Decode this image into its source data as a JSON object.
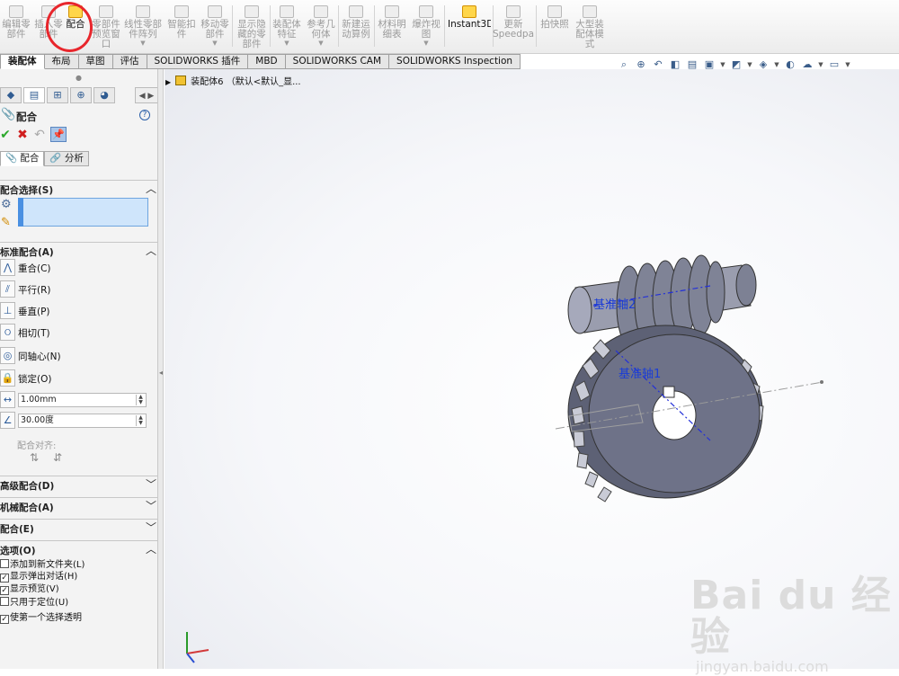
{
  "ribbon": [
    {
      "label": "编辑零\n部件",
      "active": false
    },
    {
      "label": "插入零\n部件",
      "active": false
    },
    {
      "label": "配合",
      "active": true
    },
    {
      "label": "零部件\n预览窗\n口",
      "active": false
    },
    {
      "label": "线性零部\n件阵列",
      "active": false
    },
    {
      "label": "智能扣\n件",
      "active": false
    },
    {
      "label": "移动零\n部件",
      "active": false
    },
    {
      "label": "显示隐\n藏的零\n部件",
      "active": false
    },
    {
      "label": "装配体\n特征",
      "active": false
    },
    {
      "label": "参考几\n何体",
      "active": false
    },
    {
      "label": "新建运\n动算例",
      "active": false
    },
    {
      "label": "材料明\n细表",
      "active": false
    },
    {
      "label": "爆炸视\n图",
      "active": false
    },
    {
      "label": "Instant3D",
      "active": true
    },
    {
      "label": "更新\nSpeedpak",
      "active": false
    },
    {
      "label": "拍快照",
      "active": false
    },
    {
      "label": "大型装\n配体模\n式",
      "active": false
    }
  ],
  "tabs": [
    "装配体",
    "布局",
    "草图",
    "评估",
    "SOLIDWORKS 插件",
    "MBD",
    "SOLIDWORKS CAM",
    "SOLIDWORKS Inspection"
  ],
  "viewbar_icons": [
    "zoom-to-fit-icon",
    "zoom-area-icon",
    "previous-view-icon",
    "section-view-icon",
    "dynamic-annotation-icon",
    "view-orientation-icon",
    "display-style-icon",
    "hide-show-items-icon",
    "edit-appearance-icon",
    "apply-scene-icon",
    "view-settings-icon"
  ],
  "panel": {
    "title": "配合",
    "help": "?",
    "subtabs": [
      "配合",
      "分析"
    ],
    "sections": {
      "selection": "配合选择(S)",
      "standard": "标准配合(A)",
      "advanced": "高级配合(D)",
      "mechanical": "机械配合(A)",
      "mates": "配合(E)",
      "options": "选项(O)"
    },
    "standard_mates": [
      {
        "label": "重合(C)",
        "icon": "coincident-icon"
      },
      {
        "label": "平行(R)",
        "icon": "parallel-icon"
      },
      {
        "label": "垂直(P)",
        "icon": "perpendicular-icon"
      },
      {
        "label": "相切(T)",
        "icon": "tangent-icon"
      },
      {
        "label": "同轴心(N)",
        "icon": "concentric-icon"
      },
      {
        "label": "锁定(O)",
        "icon": "lock-icon"
      }
    ],
    "distance_value": "1.00mm",
    "angle_value": "30.00度",
    "mate_alignment_label": "配合对齐:",
    "options": [
      {
        "label": "添加到新文件夹(L)",
        "checked": false
      },
      {
        "label": "显示弹出对话(H)",
        "checked": true
      },
      {
        "label": "显示预览(V)",
        "checked": true
      },
      {
        "label": "只用于定位(U)",
        "checked": false
      },
      {
        "label": "使第一个选择透明",
        "checked": true
      }
    ]
  },
  "tree": {
    "label": "装配体6 （默认<默认_显..."
  },
  "labels": {
    "axis2": "基准轴2",
    "axis1": "基准轴1"
  },
  "watermark": {
    "brand": "Bai du 经验",
    "url": "jingyan.baidu.com"
  },
  "colors": {
    "accent": "#4a90e2",
    "gear": "#6e7288",
    "highlight": "#e8262c",
    "axis_label": "#1a3dd6"
  }
}
